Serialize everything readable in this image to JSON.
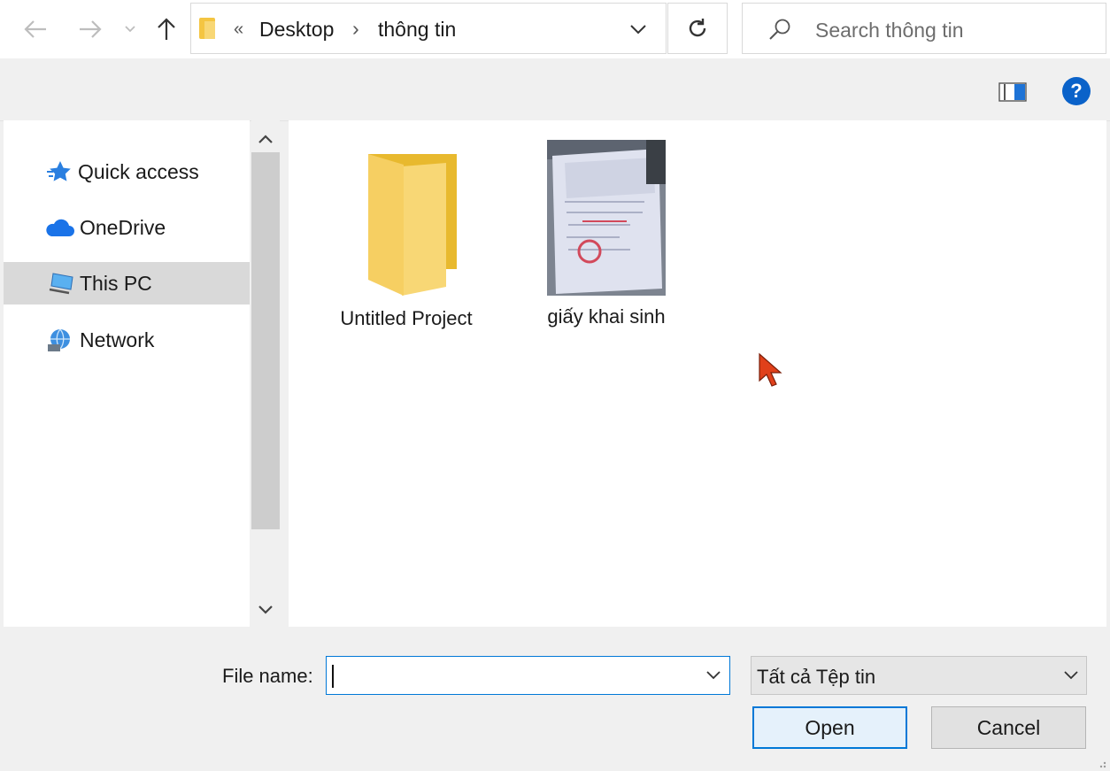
{
  "address": {
    "overflow_glyph": "«",
    "crumbs": [
      "Desktop",
      "thông tin"
    ],
    "separator_glyph": "›"
  },
  "search": {
    "placeholder": "Search thông tin"
  },
  "nav": {
    "items": [
      {
        "label": "Quick access",
        "icon": "star-icon"
      },
      {
        "label": "OneDrive",
        "icon": "cloud-icon"
      },
      {
        "label": "This PC",
        "icon": "computer-icon",
        "selected": true
      },
      {
        "label": "Network",
        "icon": "network-icon"
      }
    ]
  },
  "files": [
    {
      "name": "Untitled Project",
      "type": "folder"
    },
    {
      "name": "giấy khai sinh",
      "type": "image"
    }
  ],
  "footer": {
    "file_name_label": "File name:",
    "file_name_value": "",
    "filter_selected": "Tất cả Tệp tin",
    "open_label": "Open",
    "cancel_label": "Cancel"
  },
  "help_glyph": "?",
  "colors": {
    "accent": "#0078d7",
    "folder": "#f8d775",
    "cursor": "#e0401a"
  }
}
